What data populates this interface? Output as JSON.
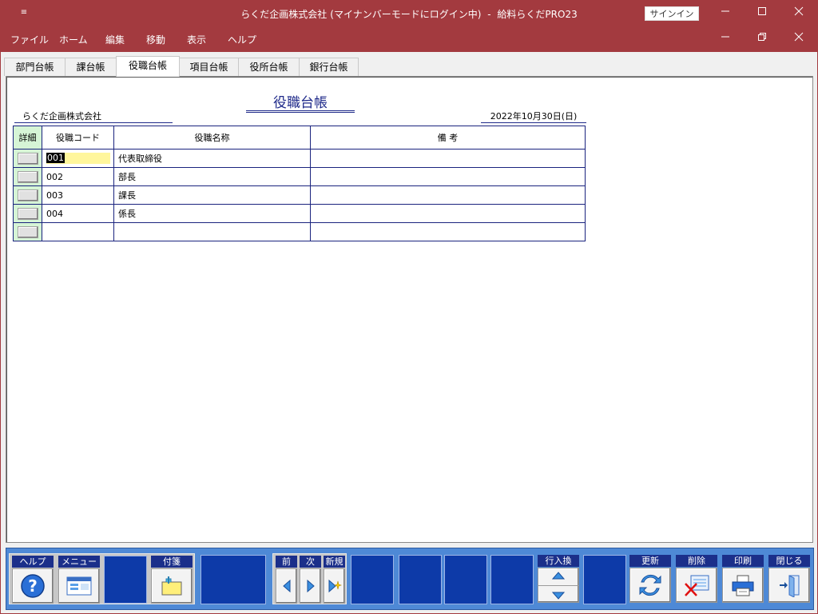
{
  "window": {
    "title_parts": [
      "らくだ企画株式会社",
      "(マイナンバーモードにログイン中)",
      "-",
      "給料らくだPRO23"
    ],
    "signin_label": "サインイン",
    "qa_glyph": "≡"
  },
  "menu": [
    "ファイル",
    "ホーム",
    "編集",
    "移動",
    "表示",
    "ヘルプ"
  ],
  "tabs": [
    "部門台帳",
    "課台帳",
    "役職台帳",
    "項目台帳",
    "役所台帳",
    "銀行台帳"
  ],
  "active_tab": "役職台帳",
  "report": {
    "title": "役職台帳",
    "company": "らくだ企画株式会社",
    "date": "2022年10月30日(日)"
  },
  "grid": {
    "headers": [
      "詳細",
      "役職コード",
      "役職名称",
      "備 考"
    ],
    "rows": [
      {
        "code": "001",
        "name": "代表取締役",
        "note": ""
      },
      {
        "code": "002",
        "name": "部長",
        "note": ""
      },
      {
        "code": "003",
        "name": "課長",
        "note": ""
      },
      {
        "code": "004",
        "name": "係長",
        "note": ""
      },
      {
        "code": "",
        "name": "",
        "note": ""
      }
    ]
  },
  "toolbar": {
    "help": "ヘルプ",
    "menu": "メニュー",
    "sticky": "付箋",
    "prev": "前",
    "next": "次",
    "new": "新規",
    "row_swap": "行入換",
    "update": "更新",
    "delete": "削除",
    "print": "印刷",
    "close": "閉じる"
  },
  "colors": {
    "frame": "#a33a3f",
    "toolbar": "#4e89d6",
    "label_bg": "#1b2f8a",
    "grid_border": "#1a237e",
    "detail_col": "#d6f5d6",
    "selected_cell": "#fff69c"
  }
}
